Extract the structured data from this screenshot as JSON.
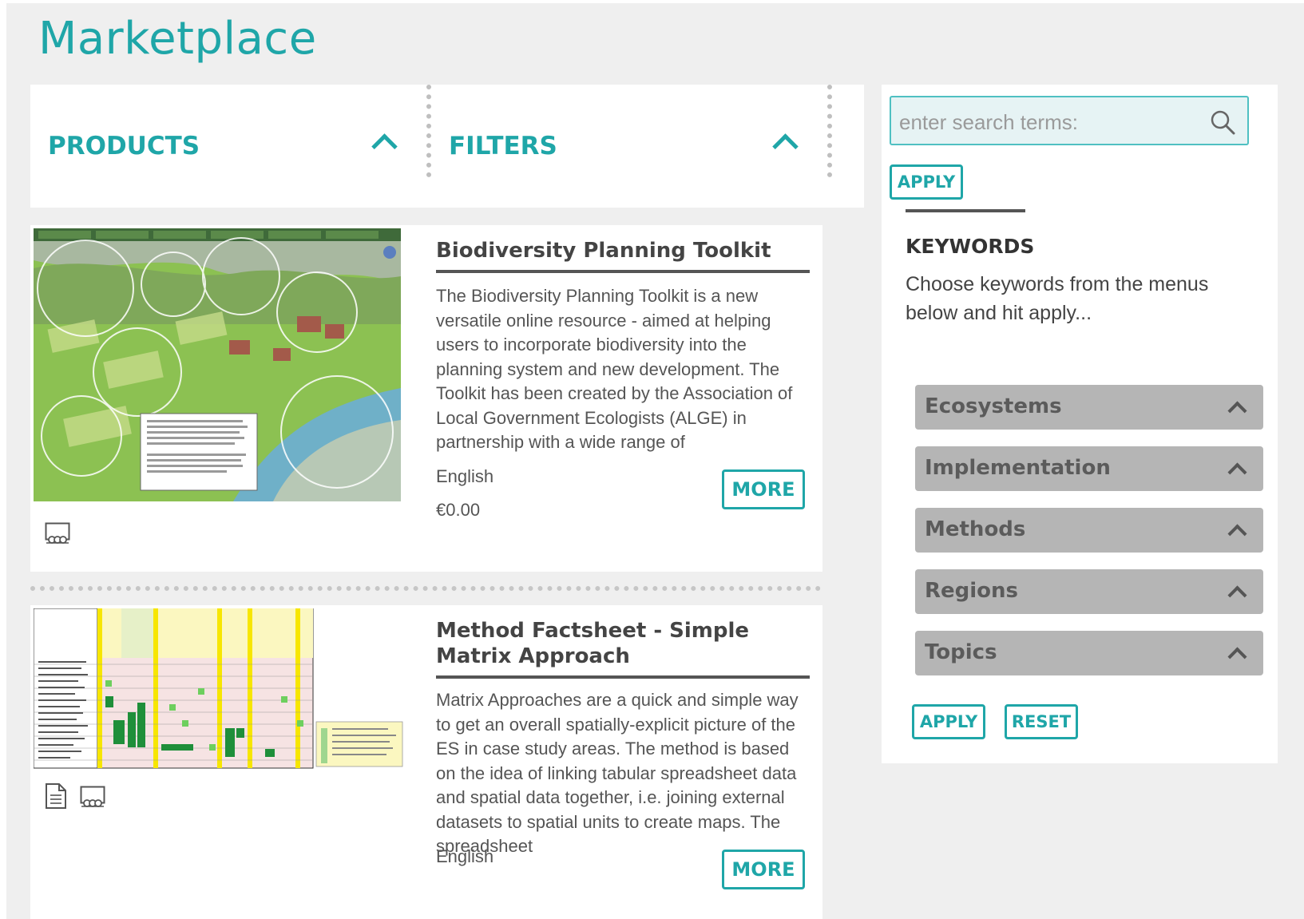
{
  "page": {
    "title": "Marketplace"
  },
  "tabs": [
    {
      "label": "PRODUCTS"
    },
    {
      "label": "FILTERS"
    }
  ],
  "search": {
    "placeholder": "enter search terms:",
    "apply_label": "APPLY"
  },
  "keywords": {
    "title": "KEYWORDS",
    "description": "Choose keywords from the menus below and hit apply...",
    "menus": [
      "Ecosystems",
      "Implementation",
      "Methods",
      "Regions",
      "Topics"
    ],
    "apply_label": "APPLY",
    "reset_label": "RESET"
  },
  "products": [
    {
      "title": "Biodiversity Planning Toolkit",
      "description": "The Biodiversity Planning Toolkit is a new versatile online resource - aimed at helping users to incorporate biodiversity into the planning system and new development. The Toolkit has been created by the Association of Local Government Ecologists (ALGE) in partnership with a wide range of",
      "language": "English",
      "price": "€0.00",
      "more_label": "MORE"
    },
    {
      "title": "Method Factsheet - Simple Matrix Approach",
      "description": "Matrix Approaches are a quick and simple way to get an overall spatially-explicit picture of the ES in case study areas. The method is based on the idea of linking tabular spreadsheet data and spatial data together, i.e. joining external datasets to spatial units to create maps. The spreadsheet",
      "language": "English",
      "more_label": "MORE"
    }
  ],
  "colors": {
    "accent": "#1fa6a8",
    "accordion": "#b5b5b5",
    "background": "#efefef"
  }
}
